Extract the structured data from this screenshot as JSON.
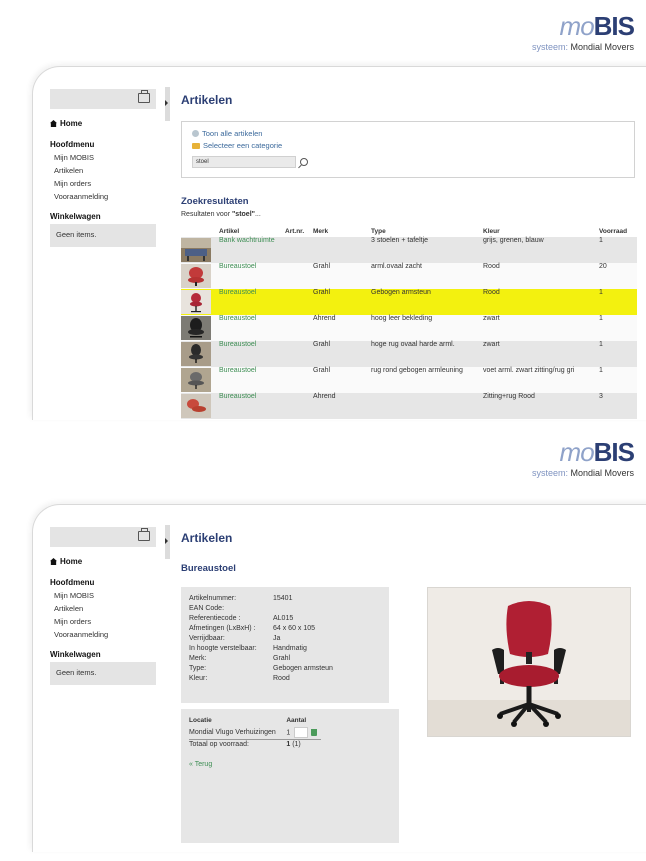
{
  "brand": {
    "logo_prefix": "mo",
    "logo_main": "BIS",
    "system_label": "systeem:",
    "system_name": "Mondial Movers"
  },
  "sidebar": {
    "home": "Home",
    "menu_heading": "Hoofdmenu",
    "items": [
      {
        "label": "Mijn MOBIS"
      },
      {
        "label": "Artikelen"
      },
      {
        "label": "Mijn orders"
      },
      {
        "label": "Vooraanmelding"
      }
    ],
    "cart_heading": "Winkelwagen",
    "cart_empty": "Geen items."
  },
  "list_page": {
    "title": "Artikelen",
    "show_all": "Toon alle artikelen",
    "select_category": "Selecteer een categorie",
    "search_value": "stoel",
    "results_heading": "Zoekresultaten",
    "results_prefix": "Resultaten voor ",
    "results_query": "\"stoel\"",
    "results_suffix": "...",
    "columns": [
      "",
      "Artikel",
      "Art.nr.",
      "Merk",
      "Type",
      "Kleur",
      "Voorraad"
    ],
    "rows": [
      {
        "artikel": "Bank wachtruimte",
        "artnr": "",
        "merk": "",
        "type": "3 stoelen + tafeltje",
        "kleur": "grijs, grenen, blauw",
        "voorraad": "1"
      },
      {
        "artikel": "Bureaustoel",
        "artnr": "",
        "merk": "Grahl",
        "type": "arml.ovaal zacht",
        "kleur": "Rood",
        "voorraad": "20"
      },
      {
        "artikel": "Bureaustoel",
        "artnr": "",
        "merk": "Grahl",
        "type": "Gebogen armsteun",
        "kleur": "Rood",
        "voorraad": "1",
        "highlighted": true
      },
      {
        "artikel": "Bureaustoel",
        "artnr": "",
        "merk": "Ahrend",
        "type": "hoog leer bekleding",
        "kleur": "zwart",
        "voorraad": "1"
      },
      {
        "artikel": "Bureaustoel",
        "artnr": "",
        "merk": "Grahl",
        "type": "hoge rug ovaal harde arml.",
        "kleur": "zwart",
        "voorraad": "1"
      },
      {
        "artikel": "Bureaustoel",
        "artnr": "",
        "merk": "Grahl",
        "type": "rug rond gebogen armleuning",
        "kleur": "voet arml. zwart zitting/rug gri",
        "voorraad": "1"
      },
      {
        "artikel": "Bureaustoel",
        "artnr": "",
        "merk": "Ahrend",
        "type": "",
        "kleur": "Zitting+rug Rood",
        "voorraad": "3"
      }
    ],
    "highlight_color": "#f3f10f"
  },
  "detail_page": {
    "title": "Artikelen",
    "subtitle": "Bureaustoel",
    "fields": [
      {
        "label": "Artikelnummer:",
        "value": "15401"
      },
      {
        "label": "EAN Code:",
        "value": ""
      },
      {
        "label": "Referentiecode :",
        "value": "AL015"
      },
      {
        "label": "Afmetingen (LxBxH) :",
        "value": "64 x 60 x 105"
      },
      {
        "label": "Verrijdbaar:",
        "value": "Ja"
      },
      {
        "label": "In hoogte verstelbaar:",
        "value": "Handmatig"
      },
      {
        "label": "Merk:",
        "value": "Grahl"
      },
      {
        "label": "Type:",
        "value": "Gebogen armsteun"
      },
      {
        "label": "Kleur:",
        "value": "Rood"
      }
    ],
    "location_header": "Locatie",
    "quantity_header": "Aantal",
    "location": "Mondial Vlugo Verhuizingen",
    "location_qty": "1",
    "total_label": "Totaal op voorraad:",
    "total_value": "1",
    "total_extra": "(1)",
    "back_link": "« Terug"
  },
  "colors": {
    "brand": "#2c3f74",
    "link": "#3e8e54",
    "panel_gray": "#e6e6e6"
  }
}
